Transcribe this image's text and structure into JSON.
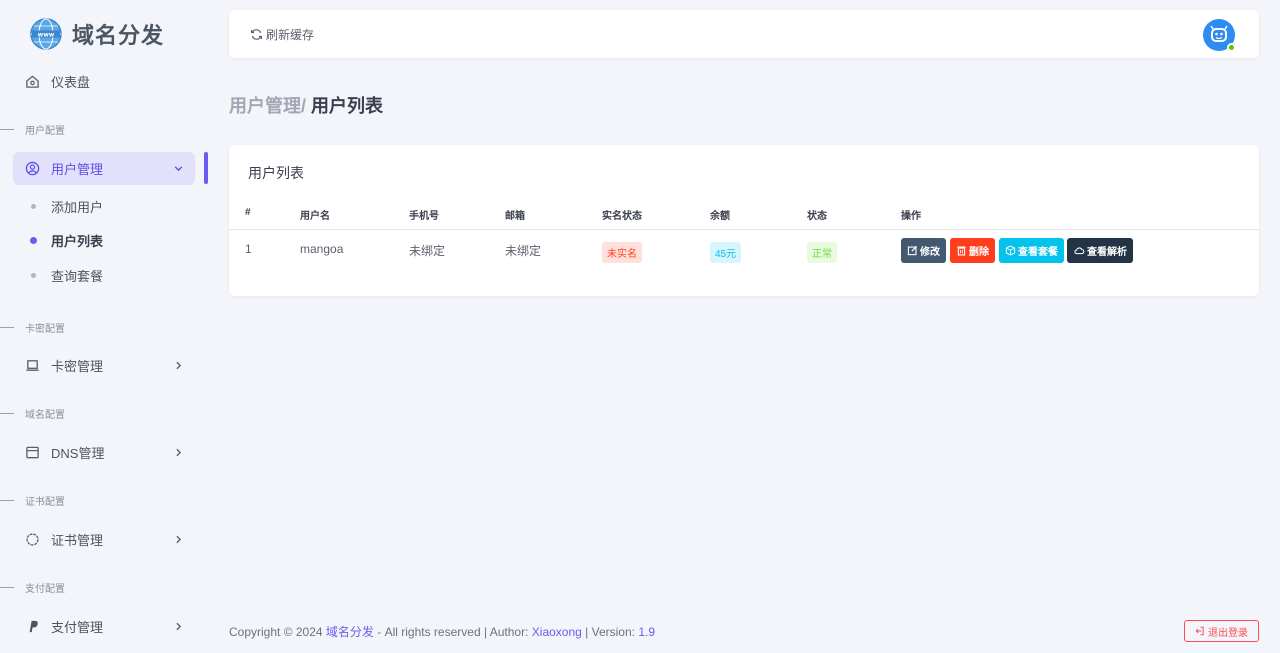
{
  "brand": {
    "name": "域名分发"
  },
  "sidebar": {
    "dashboard": "仪表盘",
    "sections": {
      "user": "用户配置",
      "card": "卡密配置",
      "domain": "域名配置",
      "cert": "证书配置",
      "pay": "支付配置"
    },
    "user_mgmt": "用户管理",
    "sub_items": [
      "添加用户",
      "用户列表",
      "查询套餐"
    ],
    "card_mgmt": "卡密管理",
    "dns_mgmt": "DNS管理",
    "cert_mgmt": "证书管理",
    "pay_mgmt": "支付管理"
  },
  "topbar": {
    "refresh_label": "刷新缓存"
  },
  "breadcrumb": {
    "parent": "用户管理/ ",
    "current": "用户列表"
  },
  "table": {
    "title": "用户列表",
    "columns": [
      "#",
      "用户名",
      "手机号",
      "邮箱",
      "实名状态",
      "余额",
      "状态",
      "操作"
    ],
    "rows": [
      {
        "id": "1",
        "username": "mangoa",
        "phone": "未绑定",
        "email": "未绑定",
        "realname": "未实名",
        "balance": "45元",
        "status": "正常"
      }
    ],
    "actions": {
      "edit": "修改",
      "delete": "删除",
      "view_package": "查看套餐",
      "view_dns": "查看解析"
    }
  },
  "footer": {
    "prefix": "Copyright © 2024 ",
    "site": "域名分发",
    "middle": " - All rights reserved | Author: ",
    "author": "Xiaoxong",
    "ver_label": " | Version: ",
    "version": "1.9"
  },
  "logout_label": "退出登录",
  "colors": {
    "primary": "#6b5cf0",
    "danger": "#ff3e1d",
    "info": "#03c3ec",
    "dark": "#233446",
    "secondary": "#435971"
  }
}
